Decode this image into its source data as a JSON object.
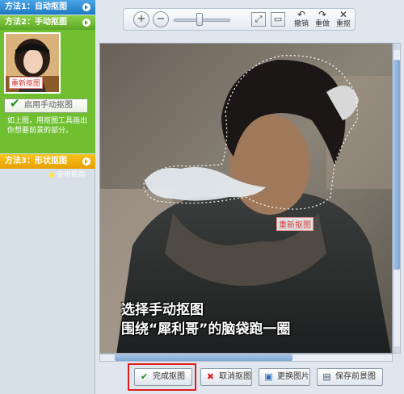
{
  "left_panel": {
    "method1": "方法1：自动抠图",
    "method2": "方法2：手动抠图",
    "method3": "方法3：形状抠图",
    "thumb_label": "重新抠图",
    "enable_button": "启用手动抠图",
    "description": "如上图，用抠图工具画出你想要前景的部分。",
    "help_link": "使用帮助"
  },
  "toolbar": {
    "undo": "撤销",
    "redo": "重做",
    "reset": "重抠",
    "zoom_level": 0.45
  },
  "canvas": {
    "redo_label": "重新抠图",
    "caption_line1": "选择手动抠图",
    "caption_line2": "围绕“犀利哥”的脑袋跑一圈"
  },
  "scroll": {
    "vertical": 0.2,
    "horizontal": 0.6
  },
  "buttons": {
    "done": "完成抠图",
    "cancel": "取消抠图",
    "replace": "更换图片",
    "save": "保存前景图"
  },
  "colors": {
    "accent_red": "#e01c1c",
    "method1": "#1e78c2",
    "method2": "#5aa726",
    "method3": "#e6a100"
  }
}
